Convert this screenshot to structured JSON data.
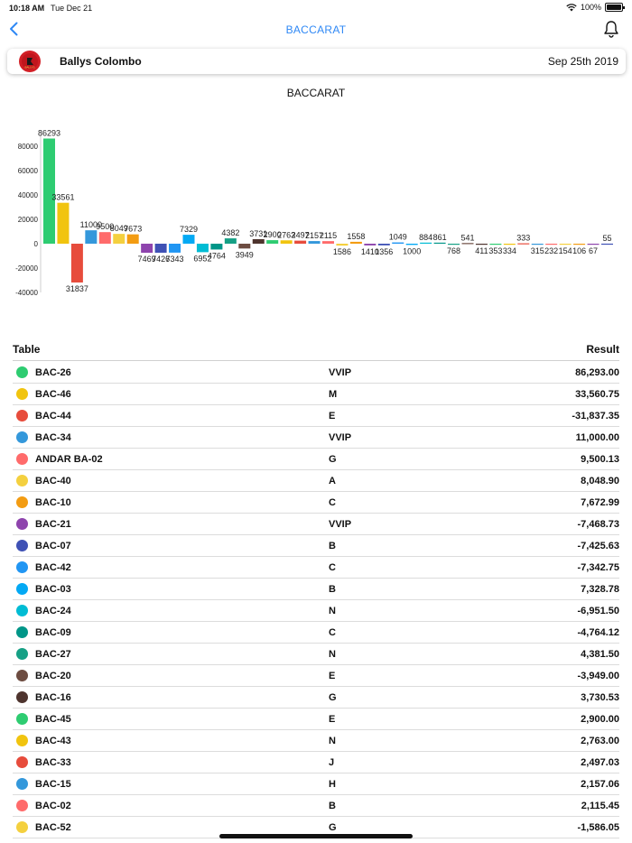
{
  "status_bar": {
    "time": "10:18 AM",
    "date": "Tue Dec 21",
    "battery": "100%"
  },
  "nav": {
    "title": "BACCARAT"
  },
  "venue": {
    "name": "Ballys Colombo",
    "date": "Sep 25th 2019",
    "logo_text": "BALLYS"
  },
  "colors": {
    "accent": "#2f88f5"
  },
  "chart_data": {
    "type": "bar",
    "title": "BACCARAT",
    "ylim": [
      -40000,
      90000
    ],
    "yticks": [
      80000,
      60000,
      40000,
      20000,
      0,
      -20000,
      -40000
    ],
    "values": [
      86293,
      33561,
      -31837,
      11000,
      9500,
      8049,
      7673,
      -7469,
      -7426,
      -7343,
      7329,
      -6952,
      -4764,
      4382,
      -3949,
      3731,
      2900,
      2763,
      2497,
      2157,
      2115,
      -1586,
      1558,
      -1410,
      -1356,
      1049,
      -1000,
      884,
      861,
      -768,
      541,
      -411,
      -353,
      -334,
      333,
      -315,
      -232,
      -154,
      -106,
      -67,
      55
    ],
    "labels": [
      "86293",
      "33561",
      "31837",
      "11000",
      "9500",
      "8049",
      "7673",
      "7469",
      "7426",
      "7343",
      "7329",
      "6952",
      "4764",
      "4382",
      "3949",
      "3731",
      "2900",
      "2763",
      "2497",
      "2157",
      "2115",
      "1586",
      "1558",
      "1410",
      "1356",
      "1049",
      "1000",
      "884",
      "861",
      "768",
      "541",
      "411",
      "353",
      "334",
      "333",
      "315",
      "232",
      "154",
      "106",
      "67",
      "55"
    ],
    "colors": [
      "#2ecc71",
      "#f1c40f",
      "#e74c3c",
      "#3498db",
      "#ff6b6b",
      "#f4d03f",
      "#f39c12",
      "#8e44ad",
      "#3f51b5",
      "#2196f3",
      "#03a9f4",
      "#00bcd4",
      "#009688",
      "#16a085",
      "#6d4c41",
      "#4e342e",
      "#2ecc71",
      "#f1c40f",
      "#e74c3c",
      "#3498db",
      "#ff6b6b",
      "#f4d03f",
      "#f39c12",
      "#8e44ad",
      "#3f51b5",
      "#2196f3",
      "#03a9f4",
      "#00bcd4",
      "#009688",
      "#16a085",
      "#6d4c41",
      "#4e342e",
      "#2ecc71",
      "#f1c40f",
      "#e74c3c",
      "#3498db",
      "#ff6b6b",
      "#f4d03f",
      "#f39c12",
      "#8e44ad",
      "#3f51b5"
    ]
  },
  "table": {
    "header_table": "Table",
    "header_result": "Result",
    "rows": [
      {
        "name": "BAC-26",
        "category": "VVIP",
        "result": "86,293.00",
        "color": "#2ecc71"
      },
      {
        "name": "BAC-46",
        "category": "M",
        "result": "33,560.75",
        "color": "#f1c40f"
      },
      {
        "name": "BAC-44",
        "category": "E",
        "result": "-31,837.35",
        "color": "#e74c3c"
      },
      {
        "name": "BAC-34",
        "category": "VVIP",
        "result": "11,000.00",
        "color": "#3498db"
      },
      {
        "name": "ANDAR BA-02",
        "category": "G",
        "result": "9,500.13",
        "color": "#ff6b6b"
      },
      {
        "name": "BAC-40",
        "category": "A",
        "result": "8,048.90",
        "color": "#f4d03f"
      },
      {
        "name": "BAC-10",
        "category": "C",
        "result": "7,672.99",
        "color": "#f39c12"
      },
      {
        "name": "BAC-21",
        "category": "VVIP",
        "result": "-7,468.73",
        "color": "#8e44ad"
      },
      {
        "name": "BAC-07",
        "category": "B",
        "result": "-7,425.63",
        "color": "#3f51b5"
      },
      {
        "name": "BAC-42",
        "category": "C",
        "result": "-7,342.75",
        "color": "#2196f3"
      },
      {
        "name": "BAC-03",
        "category": "B",
        "result": "7,328.78",
        "color": "#03a9f4"
      },
      {
        "name": "BAC-24",
        "category": "N",
        "result": "-6,951.50",
        "color": "#00bcd4"
      },
      {
        "name": "BAC-09",
        "category": "C",
        "result": "-4,764.12",
        "color": "#009688"
      },
      {
        "name": "BAC-27",
        "category": "N",
        "result": "4,381.50",
        "color": "#16a085"
      },
      {
        "name": "BAC-20",
        "category": "E",
        "result": "-3,949.00",
        "color": "#6d4c41"
      },
      {
        "name": "BAC-16",
        "category": "G",
        "result": "3,730.53",
        "color": "#4e342e"
      },
      {
        "name": "BAC-45",
        "category": "E",
        "result": "2,900.00",
        "color": "#2ecc71"
      },
      {
        "name": "BAC-43",
        "category": "N",
        "result": "2,763.00",
        "color": "#f1c40f"
      },
      {
        "name": "BAC-33",
        "category": "J",
        "result": "2,497.03",
        "color": "#e74c3c"
      },
      {
        "name": "BAC-15",
        "category": "H",
        "result": "2,157.06",
        "color": "#3498db"
      },
      {
        "name": "BAC-02",
        "category": "B",
        "result": "2,115.45",
        "color": "#ff6b6b"
      },
      {
        "name": "BAC-52",
        "category": "G",
        "result": "-1,586.05",
        "color": "#f4d03f"
      }
    ]
  }
}
